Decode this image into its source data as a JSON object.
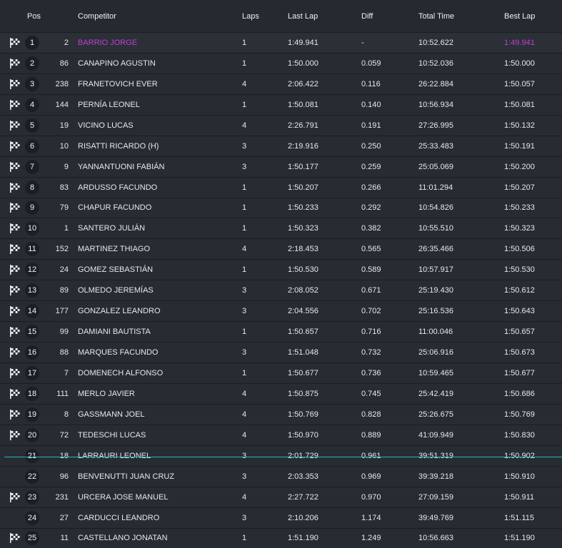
{
  "header": {
    "pos": "Pos",
    "competitor": "Competitor",
    "laps": "Laps",
    "last_lap": "Last Lap",
    "diff": "Diff",
    "total_time": "Total Time",
    "best_lap": "Best Lap"
  },
  "colors": {
    "fastest": "#c43cd2",
    "separator": "#2fb1b8"
  },
  "rows": [
    {
      "flag": true,
      "pos": "1",
      "num": "2",
      "name": "BARRIO JORGE",
      "laps": "1",
      "last": "1:49.941",
      "diff": "-",
      "total": "10:52.622",
      "best": "1:49.941"
    },
    {
      "flag": true,
      "pos": "2",
      "num": "86",
      "name": "CANAPINO AGUSTIN",
      "laps": "1",
      "last": "1:50.000",
      "diff": "0.059",
      "total": "10:52.036",
      "best": "1:50.000"
    },
    {
      "flag": true,
      "pos": "3",
      "num": "238",
      "name": "FRANETOVICH EVER",
      "laps": "4",
      "last": "2:06.422",
      "diff": "0.116",
      "total": "26:22.884",
      "best": "1:50.057"
    },
    {
      "flag": true,
      "pos": "4",
      "num": "144",
      "name": "PERNÍA LEONEL",
      "laps": "1",
      "last": "1:50.081",
      "diff": "0.140",
      "total": "10:56.934",
      "best": "1:50.081"
    },
    {
      "flag": true,
      "pos": "5",
      "num": "19",
      "name": "VICINO LUCAS",
      "laps": "4",
      "last": "2:26.791",
      "diff": "0.191",
      "total": "27:26.995",
      "best": "1:50.132"
    },
    {
      "flag": true,
      "pos": "6",
      "num": "10",
      "name": "RISATTI RICARDO (H)",
      "laps": "3",
      "last": "2:19.916",
      "diff": "0.250",
      "total": "25:33.483",
      "best": "1:50.191"
    },
    {
      "flag": true,
      "pos": "7",
      "num": "9",
      "name": "YANNANTUONI FABIÁN",
      "laps": "3",
      "last": "1:50.177",
      "diff": "0.259",
      "total": "25:05.069",
      "best": "1:50.200"
    },
    {
      "flag": true,
      "pos": "8",
      "num": "83",
      "name": "ARDUSSO FACUNDO",
      "laps": "1",
      "last": "1:50.207",
      "diff": "0.266",
      "total": "11:01.294",
      "best": "1:50.207"
    },
    {
      "flag": true,
      "pos": "9",
      "num": "79",
      "name": "CHAPUR FACUNDO",
      "laps": "1",
      "last": "1:50.233",
      "diff": "0.292",
      "total": "10:54.826",
      "best": "1:50.233"
    },
    {
      "flag": true,
      "pos": "10",
      "num": "1",
      "name": "SANTERO JULIÁN",
      "laps": "1",
      "last": "1:50.323",
      "diff": "0.382",
      "total": "10:55.510",
      "best": "1:50.323"
    },
    {
      "flag": true,
      "pos": "11",
      "num": "152",
      "name": "MARTINEZ THIAGO",
      "laps": "4",
      "last": "2:18.453",
      "diff": "0.565",
      "total": "26:35.466",
      "best": "1:50.506"
    },
    {
      "flag": true,
      "pos": "12",
      "num": "24",
      "name": "GOMEZ SEBASTIÁN",
      "laps": "1",
      "last": "1:50.530",
      "diff": "0.589",
      "total": "10:57.917",
      "best": "1:50.530"
    },
    {
      "flag": true,
      "pos": "13",
      "num": "89",
      "name": "OLMEDO JEREMÍAS",
      "laps": "3",
      "last": "2:08.052",
      "diff": "0.671",
      "total": "25:19.430",
      "best": "1:50.612"
    },
    {
      "flag": true,
      "pos": "14",
      "num": "177",
      "name": "GONZALEZ LEANDRO",
      "laps": "3",
      "last": "2:04.556",
      "diff": "0.702",
      "total": "25:16.536",
      "best": "1:50.643"
    },
    {
      "flag": true,
      "pos": "15",
      "num": "99",
      "name": "DAMIANI BAUTISTA",
      "laps": "1",
      "last": "1:50.657",
      "diff": "0.716",
      "total": "11:00.046",
      "best": "1:50.657"
    },
    {
      "flag": true,
      "pos": "16",
      "num": "88",
      "name": "MARQUES FACUNDO",
      "laps": "3",
      "last": "1:51.048",
      "diff": "0.732",
      "total": "25:06.916",
      "best": "1:50.673"
    },
    {
      "flag": true,
      "pos": "17",
      "num": "7",
      "name": "DOMENECH ALFONSO",
      "laps": "1",
      "last": "1:50.677",
      "diff": "0.736",
      "total": "10:59.465",
      "best": "1:50.677"
    },
    {
      "flag": true,
      "pos": "18",
      "num": "111",
      "name": "MERLO JAVIER",
      "laps": "4",
      "last": "1:50.875",
      "diff": "0.745",
      "total": "25:42.419",
      "best": "1:50.686"
    },
    {
      "flag": true,
      "pos": "19",
      "num": "8",
      "name": "GASSMANN JOEL",
      "laps": "4",
      "last": "1:50.769",
      "diff": "0.828",
      "total": "25:26.675",
      "best": "1:50.769"
    },
    {
      "flag": true,
      "pos": "20",
      "num": "72",
      "name": "TEDESCHI LUCAS",
      "laps": "4",
      "last": "1:50.970",
      "diff": "0.889",
      "total": "41:09.949",
      "best": "1:50.830"
    },
    {
      "flag": false,
      "pos": "21",
      "num": "18",
      "name": "LARRAURI LEONEL",
      "laps": "3",
      "last": "2:01.729",
      "diff": "0.961",
      "total": "39:51.319",
      "best": "1:50.902"
    },
    {
      "flag": false,
      "pos": "22",
      "num": "96",
      "name": "BENVENUTTI JUAN CRUZ",
      "laps": "3",
      "last": "2:03.353",
      "diff": "0.969",
      "total": "39:39.218",
      "best": "1:50.910"
    },
    {
      "flag": true,
      "pos": "23",
      "num": "231",
      "name": "URCERA JOSE MANUEL",
      "laps": "4",
      "last": "2:27.722",
      "diff": "0.970",
      "total": "27:09.159",
      "best": "1:50.911"
    },
    {
      "flag": false,
      "pos": "24",
      "num": "27",
      "name": "CARDUCCI LEANDRO",
      "laps": "3",
      "last": "2:10.206",
      "diff": "1.174",
      "total": "39:49.769",
      "best": "1:51.115"
    },
    {
      "flag": true,
      "pos": "25",
      "num": "11",
      "name": "CASTELLANO JONATAN",
      "laps": "1",
      "last": "1:51.190",
      "diff": "1.249",
      "total": "10:56.663",
      "best": "1:51.190"
    }
  ]
}
